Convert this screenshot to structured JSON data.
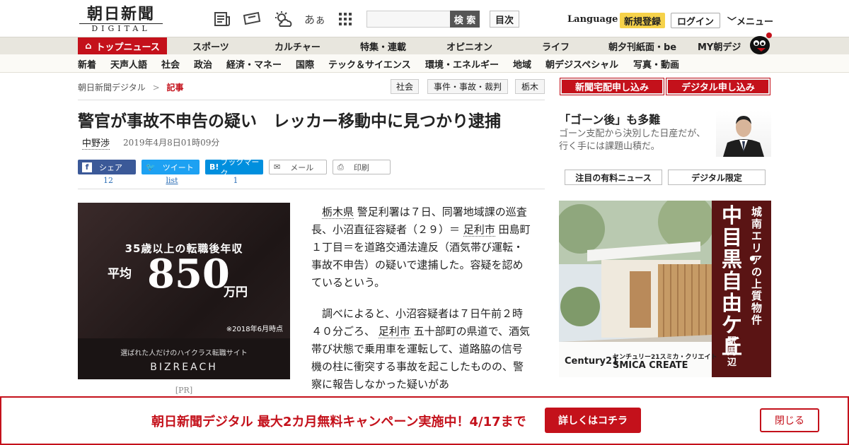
{
  "header": {
    "logo_main": "朝日新聞",
    "logo_sub": "DIGITAL",
    "icon_text_size": "あぁ",
    "search_button": "検 索",
    "mokuji": "目次",
    "language": "Language",
    "register": "新規登録",
    "login": "ログイン",
    "menu": "メニュー"
  },
  "nav_primary": [
    "トップニュース",
    "スポーツ",
    "カルチャー",
    "特集・連載",
    "オピニオン",
    "ライフ",
    "朝夕刊紙面・be",
    "MY朝デジ"
  ],
  "nav_secondary": [
    "新着",
    "天声人語",
    "社会",
    "政治",
    "経済・マネー",
    "国際",
    "テック＆サイエンス",
    "環境・エネルギー",
    "地域",
    "朝デジスペシャル",
    "写真・動画"
  ],
  "breadcrumb": {
    "home": "朝日新聞デジタル",
    "sep": ">",
    "current": "記事"
  },
  "tags": [
    "社会",
    "事件・事故・裁判",
    "栃木"
  ],
  "subscribe": {
    "paper": "新聞宅配申し込み",
    "digital": "デジタル申し込み"
  },
  "article": {
    "title": "警官が事故不申告の疑い　レッカー移動中に見つかり逮捕",
    "author": "中野渉",
    "date": "2019年4月8日01時09分",
    "p1_a": "栃木県",
    "p1_b": "警足利署は７日、同署地域課の巡査長、小沼直征容疑者（２９）＝",
    "p1_c": "足利市",
    "p1_d": "田島町１丁目＝を道路交通法違反（酒気帯び運転・事故不申告）の疑いで逮捕した。容疑を認めているという。",
    "p2_a": "調べによると、小沼容疑者は７日午前２時４０分ごろ、",
    "p2_b": "足利市",
    "p2_c": "五十部町の県道で、酒気帯び状態で乗用車を運転して、道路脇の信号機の柱に衝突する事故を起こしたものの、警察に報告しなかった疑いがあ"
  },
  "share": {
    "facebook": "シェア",
    "facebook_count": "12",
    "twitter": "ツイート",
    "twitter_count": "list",
    "hatena": "ブックマーク",
    "hatena_count": "1",
    "mail": "メール",
    "print": "印刷"
  },
  "ad_left": {
    "line1": "35歳以上の転職後年収",
    "prefix": "平均",
    "number": "850",
    "suffix": "万円",
    "note": "※2018年6月時点",
    "tagline": "選ばれた人だけのハイクラス転職サイト",
    "brand": "BIZREACH",
    "pr": "[PR]"
  },
  "sidebar": {
    "headline": "「ゴーン後」も多難",
    "summary": "ゴーン支配から決別した日産だが、行く手には課題山積だ。",
    "btn_paid": "注目の有料ニュース",
    "btn_digital": "デジタル限定"
  },
  "ad_right": {
    "title": "中目黒・自由ケ丘",
    "subtitle": "城南エリアの上質物件",
    "station": "駅周辺",
    "brand_logo": "Century21",
    "company_jp": "センチュリー21スミカ・クリエイト",
    "company_en": "SMICA CREATE"
  },
  "banner": {
    "text": "朝日新聞デジタル 最大2カ月無料キャンペーン実施中！4/17まで",
    "more": "詳しくはコチラ",
    "close": "閉じる"
  },
  "colors": {
    "brand_red": "#c4111b",
    "facebook": "#3b5998",
    "twitter": "#1da1f2",
    "hatena": "#008fde",
    "register_yellow": "#f6d24a"
  }
}
